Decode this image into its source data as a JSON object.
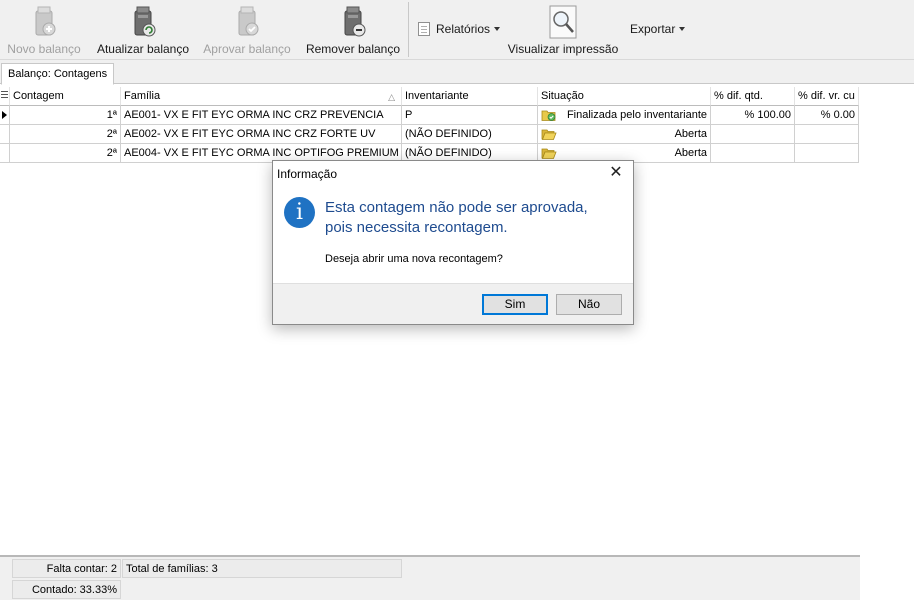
{
  "toolbar": {
    "buttons": [
      {
        "label": "Novo balanço",
        "icon": "new-inventory-icon",
        "enabled": false
      },
      {
        "label": "Atualizar balanço",
        "icon": "refresh-inventory-icon",
        "enabled": true
      },
      {
        "label": "Aprovar balanço",
        "icon": "approve-inventory-icon",
        "enabled": false
      },
      {
        "label": "Remover balanço",
        "icon": "remove-inventory-icon",
        "enabled": true
      }
    ],
    "reports_label": "Relatórios",
    "print_preview_label": "Visualizar impressão",
    "export_label": "Exportar"
  },
  "tabs": [
    {
      "label": "Balanço: Contagens",
      "active": true
    }
  ],
  "grid": {
    "columns": [
      "Contagem",
      "Família",
      "Inventariante",
      "Situação",
      "% dif. qtd.",
      "% dif. vr. cu"
    ],
    "sorted_column": "Família",
    "rows": [
      {
        "contagem": "1ª",
        "familia": "AE001- VX E FIT EYC ORMA INC CRZ PREVENCIA",
        "inventariante": "P",
        "situacao": "Finalizada pelo inventariante",
        "situacao_icon": "finished-folder-icon",
        "dif_qtd": "% 100.00",
        "dif_vr": "% 0.00",
        "current": true
      },
      {
        "contagem": "2ª",
        "familia": "AE002- VX E FIT EYC ORMA INC CRZ FORTE UV",
        "inventariante": "(NÃO DEFINIDO)",
        "situacao": "Aberta",
        "situacao_icon": "open-folder-icon",
        "dif_qtd": "",
        "dif_vr": "",
        "current": false
      },
      {
        "contagem": "2ª",
        "familia": "AE004- VX E FIT EYC ORMA INC OPTIFOG PREMIUM",
        "inventariante": "(NÃO DEFINIDO)",
        "situacao": "Aberta",
        "situacao_icon": "open-folder-icon",
        "dif_qtd": "",
        "dif_vr": "",
        "current": false
      }
    ]
  },
  "footer": {
    "falta_contar": "Falta contar: 2",
    "total_familias": "Total de famílias: 3",
    "contado": "Contado: 33.33%"
  },
  "dialog": {
    "title": "Informação",
    "message_line1": "Esta contagem não pode ser aprovada,",
    "message_line2": "pois necessita recontagem.",
    "question": "Deseja abrir uma nova recontagem?",
    "yes_label": "Sim",
    "no_label": "Não",
    "info_glyph": "i",
    "close_glyph": "✕"
  },
  "colors": {
    "dialog_message": "#1e4b8f",
    "info_icon": "#1f72c3",
    "default_button_border": "#0078d7"
  }
}
